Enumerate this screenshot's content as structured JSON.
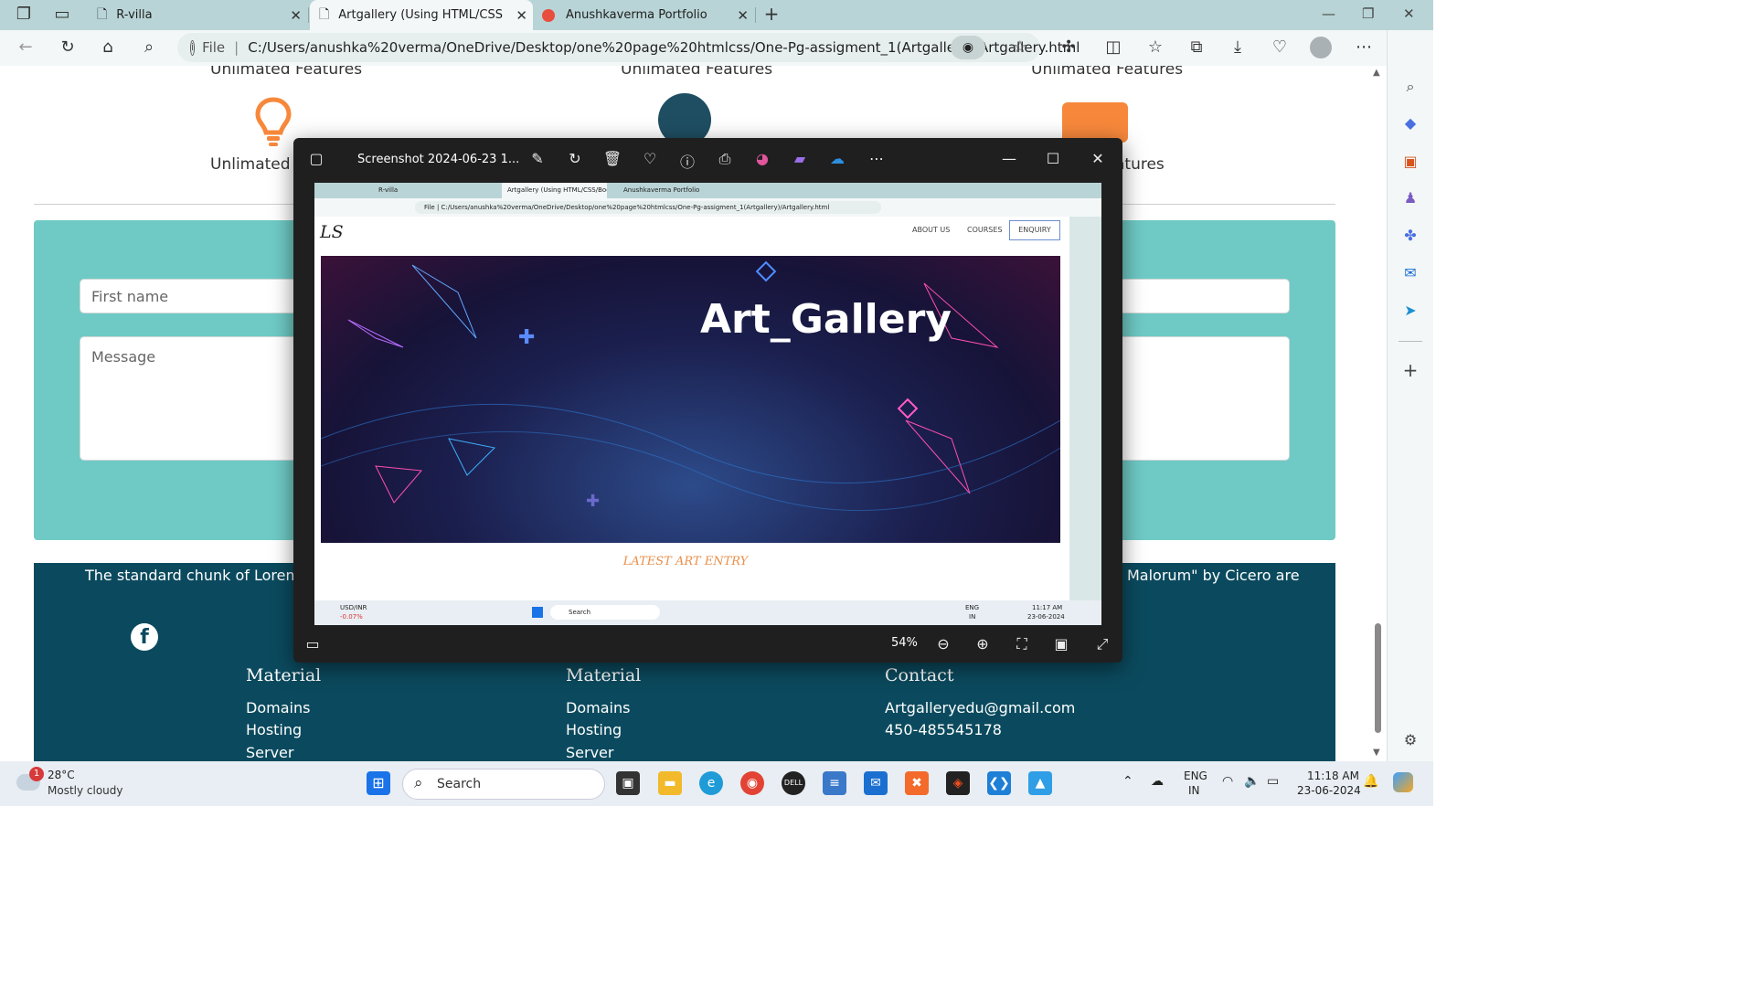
{
  "tabs": [
    {
      "title": "R-villa"
    },
    {
      "title": "Artgallery (Using HTML/CSS/Boo"
    },
    {
      "title": "Anushkaverma Portfolio"
    }
  ],
  "address": {
    "file_label": "File",
    "url": "C:/Users/anushka%20verma/OneDrive/Desktop/one%20page%20htmlcss/One-Pg-assigment_1(Artgallery)/Artgallery.html"
  },
  "features": {
    "label": "Unlimated Features",
    "cut_left": "Unlimated Fe",
    "cut_right": "atures"
  },
  "form": {
    "first_name_placeholder": "First name",
    "message_placeholder": "Message"
  },
  "footer": {
    "lorem_left": "The standard chunk of Lorem Ip",
    "lorem_right": "Malorum\" by Cicero are",
    "columns": [
      {
        "title": "Material",
        "items": [
          "Domains",
          "Hosting",
          "Server"
        ]
      },
      {
        "title": "Material",
        "items": [
          "Domains",
          "Hosting",
          "Server"
        ]
      },
      {
        "title": "Contact",
        "items": [
          "Artgalleryedu@gmail.com",
          "450-485545178"
        ]
      }
    ]
  },
  "viewer": {
    "title": "Screenshot 2024-06-23 1...",
    "zoom": "54%",
    "inner": {
      "tabs": [
        "R-villa",
        "Artgallery (Using HTML/CSS/Boo",
        "Anushkaverma Portfolio"
      ],
      "file_label": "File",
      "logo": "LS",
      "nav": [
        "ABOUT US",
        "COURSES",
        "ENQUIRY"
      ],
      "hero_title": "Art_Gallery",
      "latest": "LATEST ART ENTRY",
      "ticker_name": "USD/INR",
      "ticker_change": "-0.07%",
      "search": "Search",
      "lang": "ENG",
      "region": "IN",
      "time": "11:17 AM",
      "date": "23-06-2024"
    }
  },
  "taskbar": {
    "weather_temp": "28°C",
    "weather_desc": "Mostly cloudy",
    "weather_badge": "1",
    "search": "Search",
    "lang": "ENG",
    "region": "IN",
    "time": "11:18 AM",
    "date": "23-06-2024"
  },
  "colors": {
    "accent_teal": "#6fcac5",
    "footer_bg": "#0b4a5e",
    "orange": "#f7883b"
  }
}
